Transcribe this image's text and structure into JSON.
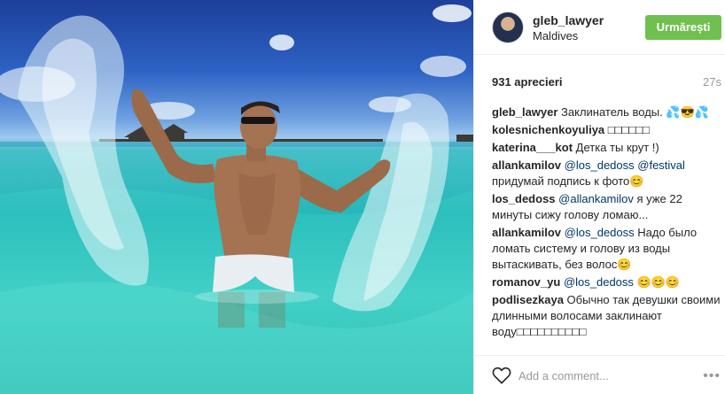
{
  "post": {
    "username": "gleb_lawyer",
    "location": "Maldives",
    "follow_label": "Urmărești",
    "likes": "931 aprecieri",
    "time": "27s",
    "caption": {
      "user": "gleb_lawyer",
      "text": " Заклинатель воды. 💦😎💦"
    }
  },
  "comments": [
    {
      "user": "kolesnichenkoyuliya",
      "parts": [
        {
          "t": " □□□□□□",
          "m": false
        }
      ]
    },
    {
      "user": "katerina___kot",
      "parts": [
        {
          "t": " Детка ты крут !)",
          "m": false
        }
      ]
    },
    {
      "user": "allankamilov",
      "parts": [
        {
          "t": " ",
          "m": false
        },
        {
          "t": "@los_dedoss",
          "m": true
        },
        {
          "t": " ",
          "m": false
        },
        {
          "t": "@festival",
          "m": true
        },
        {
          "t": " придумай подпись к фото😊",
          "m": false
        }
      ]
    },
    {
      "user": "los_dedoss",
      "parts": [
        {
          "t": " ",
          "m": false
        },
        {
          "t": "@allankamilov",
          "m": true
        },
        {
          "t": " я уже 22 минуты сижу голову ломаю...",
          "m": false
        }
      ]
    },
    {
      "user": "allankamilov",
      "parts": [
        {
          "t": " ",
          "m": false
        },
        {
          "t": "@los_dedoss",
          "m": true
        },
        {
          "t": " Надо было ломать систему и голову из воды вытаскивать, без волос😊",
          "m": false
        }
      ]
    },
    {
      "user": "romanov_yu",
      "parts": [
        {
          "t": " ",
          "m": false
        },
        {
          "t": "@los_dedoss",
          "m": true
        },
        {
          "t": " 😊😊😊",
          "m": false
        }
      ]
    },
    {
      "user": "podlisezkaya",
      "parts": [
        {
          "t": " Обычно так девушки своими длинными волосами заклинают воду□□□□□□□□□□",
          "m": false
        }
      ]
    }
  ],
  "footer": {
    "comment_placeholder": "Add a comment...",
    "more_label": "•••"
  },
  "icons": {
    "like": "heart-icon",
    "more": "more-icon"
  },
  "colors": {
    "follow_button": "#70c050",
    "mention": "#003569",
    "muted": "#999999"
  }
}
